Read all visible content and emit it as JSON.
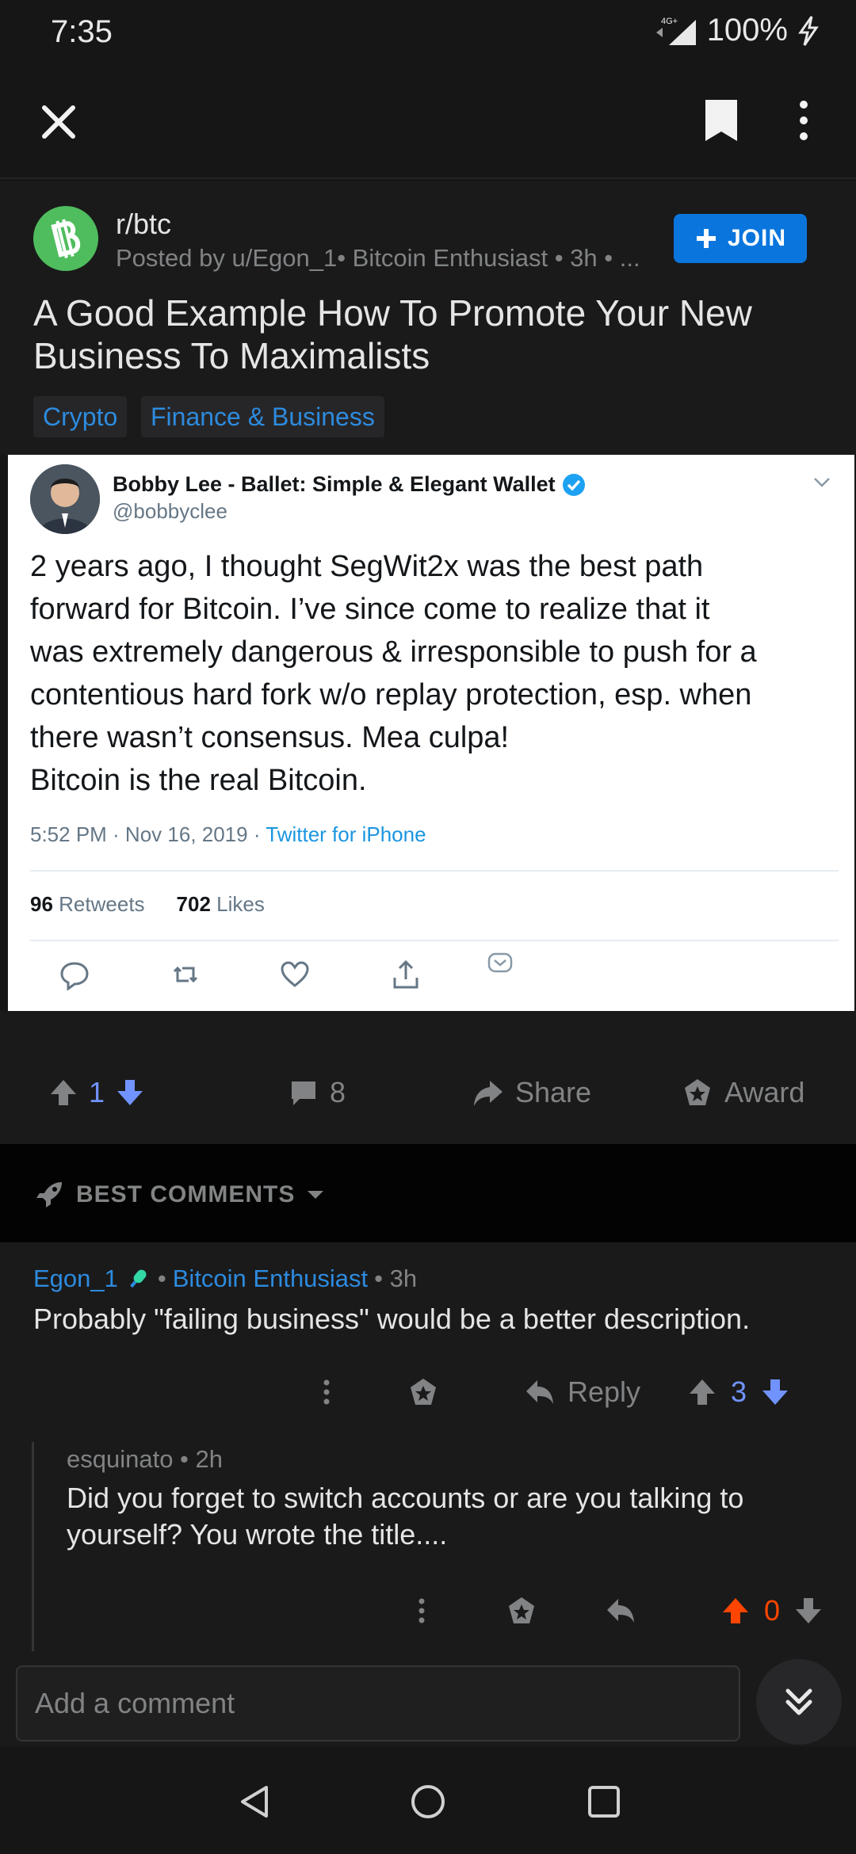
{
  "status_bar": {
    "time": "7:35",
    "network": "4G+",
    "battery": "100%"
  },
  "post": {
    "subreddit": "r/btc",
    "posted_by": "Posted by u/Egon_1• Bitcoin Enthusiast • 3h • ...",
    "join_label": "JOIN",
    "title": "A Good Example How To Promote Your New Business To Maximalists",
    "flairs": [
      "Crypto",
      "Finance & Business"
    ]
  },
  "tweet": {
    "author": "Bobby Lee - Ballet: Simple & Elegant Wallet",
    "handle": "@bobbyclee",
    "text": "2 years ago, I thought SegWit2x was the best path\nforward for Bitcoin. I’ve since come to realize that it\nwas extremely dangerous & irresponsible to push for a\ncontentious hard fork w/o replay protection, esp. when\nthere wasn’t consensus. Mea culpa!\nBitcoin is the real Bitcoin.",
    "time": "5:52 PM · Nov 16, 2019 · ",
    "source": "Twitter for iPhone",
    "retweets_count": "96",
    "retweets_label": "Retweets",
    "likes_count": "702",
    "likes_label": "Likes"
  },
  "actions": {
    "votes": "1",
    "comments": "8",
    "share": "Share",
    "award": "Award"
  },
  "sort": {
    "label": "BEST COMMENTS"
  },
  "comments": [
    {
      "user": "Egon_1",
      "flair": "Bitcoin Enthusiast",
      "age": "• 3h",
      "body": "Probably \"failing business\" would be a better description.",
      "reply": "Reply",
      "votes": "3"
    },
    {
      "user": "esquinato",
      "age": "• 2h",
      "meta": "esquinato • 2h",
      "body": "Did you forget to switch accounts or are you talking to yourself? You wrote the title....",
      "votes": "0"
    }
  ],
  "input": {
    "placeholder": "Add a comment"
  },
  "colors": {
    "accent": "#0a76dd",
    "upvote": "#ff4500",
    "downvote": "#7193ff"
  }
}
